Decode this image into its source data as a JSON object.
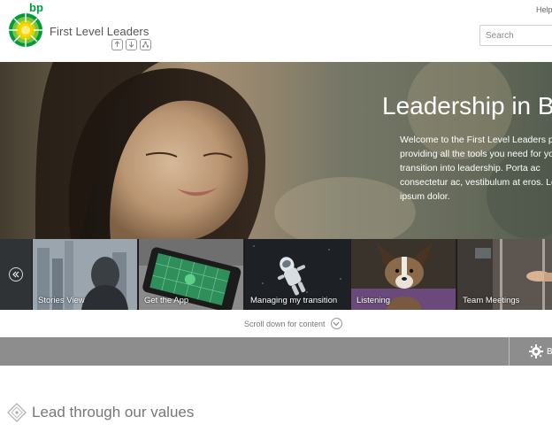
{
  "header": {
    "brand": "bp",
    "site_title": "First Level Leaders",
    "help_label": "Help",
    "search_placeholder": "Search",
    "icons": [
      "upload-icon",
      "download-icon",
      "share-icon"
    ]
  },
  "hero": {
    "headline": "Leadership in BP",
    "body": "Welcome to the First Level Leaders portal; providing all the tools you need for your transition into leadership. Porta ac consectetur ac, vestibulum at eros. Lorem ipsum dolor."
  },
  "tiles": [
    {
      "label": "Stories View",
      "icon": "cityscape"
    },
    {
      "label": "Get the App",
      "icon": "phone"
    },
    {
      "label": "Managing my transition",
      "icon": "astronaut"
    },
    {
      "label": "Listening",
      "icon": "dog"
    },
    {
      "label": "Team Meetings",
      "icon": "door"
    }
  ],
  "scroll_hint": "Scroll down for content",
  "band": {
    "button_label": "B"
  },
  "section": {
    "title": "Lead through our values"
  },
  "colors": {
    "brand_green": "#009b3a",
    "brand_yellow": "#ffd200",
    "band_grey": "#8d8d8d"
  }
}
